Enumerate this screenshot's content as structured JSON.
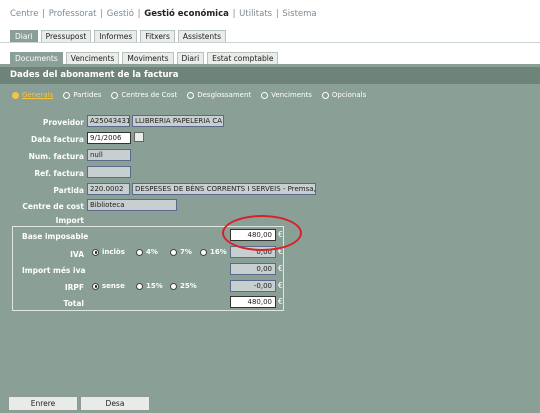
{
  "topnav": {
    "items": [
      "Centre",
      "Professorat",
      "Gestió",
      "Gestió económica",
      "Utilitats",
      "Sistema"
    ],
    "separator": "|"
  },
  "tabs_primary": [
    "Diari",
    "Pressupost",
    "Informes",
    "Fitxers",
    "Assistents"
  ],
  "tabs_secondary": [
    "Documents",
    "Venciments",
    "Moviments",
    "Diari",
    "Estat comptable"
  ],
  "section_title": "Dades del abonament de la factura",
  "subtabs": [
    "Generals",
    "Partides",
    "Centres de Cost",
    "Desglossament",
    "Venciments",
    "Opcionals"
  ],
  "form": {
    "proveidor_label": "Proveidor",
    "proveidor_code": "A25043431",
    "proveidor_name": "LLIBRERIA PAPELERIA CA",
    "data_label": "Data factura",
    "data_value": "9/1/2006",
    "num_label": "Num. factura",
    "num_value": "null",
    "ref_label": "Ref. factura",
    "ref_value": "",
    "partida_label": "Partida",
    "partida_code": "220.0002",
    "partida_desc": "DESPESES DE BÉNS CORRENTS I SERVEIS - Premsa, r",
    "centre_label": "Centre de cost",
    "centre_value": "Biblioteca",
    "import_label": "Import"
  },
  "import": {
    "base_label": "Base imposable",
    "base_value": "480,00",
    "iva_label": "IVA",
    "iva_options": [
      "inclòs",
      "4%",
      "7%",
      "16%"
    ],
    "iva_selected": "inclòs",
    "iva_value": "0,00",
    "imp_iva_label": "Import més iva",
    "imp_iva_value": "0,00",
    "irpf_label": "IRPF",
    "irpf_options": [
      "sense",
      "15%",
      "25%"
    ],
    "irpf_selected": "sense",
    "irpf_value": "-0,00",
    "total_label": "Total",
    "total_value": "480,00",
    "currency": "€"
  },
  "buttons": {
    "save": "Enrere",
    "cancel": "Desa"
  },
  "colors": {
    "panel": "#8a9f96",
    "title": "#6f8479",
    "accent": "#f5c542",
    "highlight_ring": "#d8202a"
  }
}
